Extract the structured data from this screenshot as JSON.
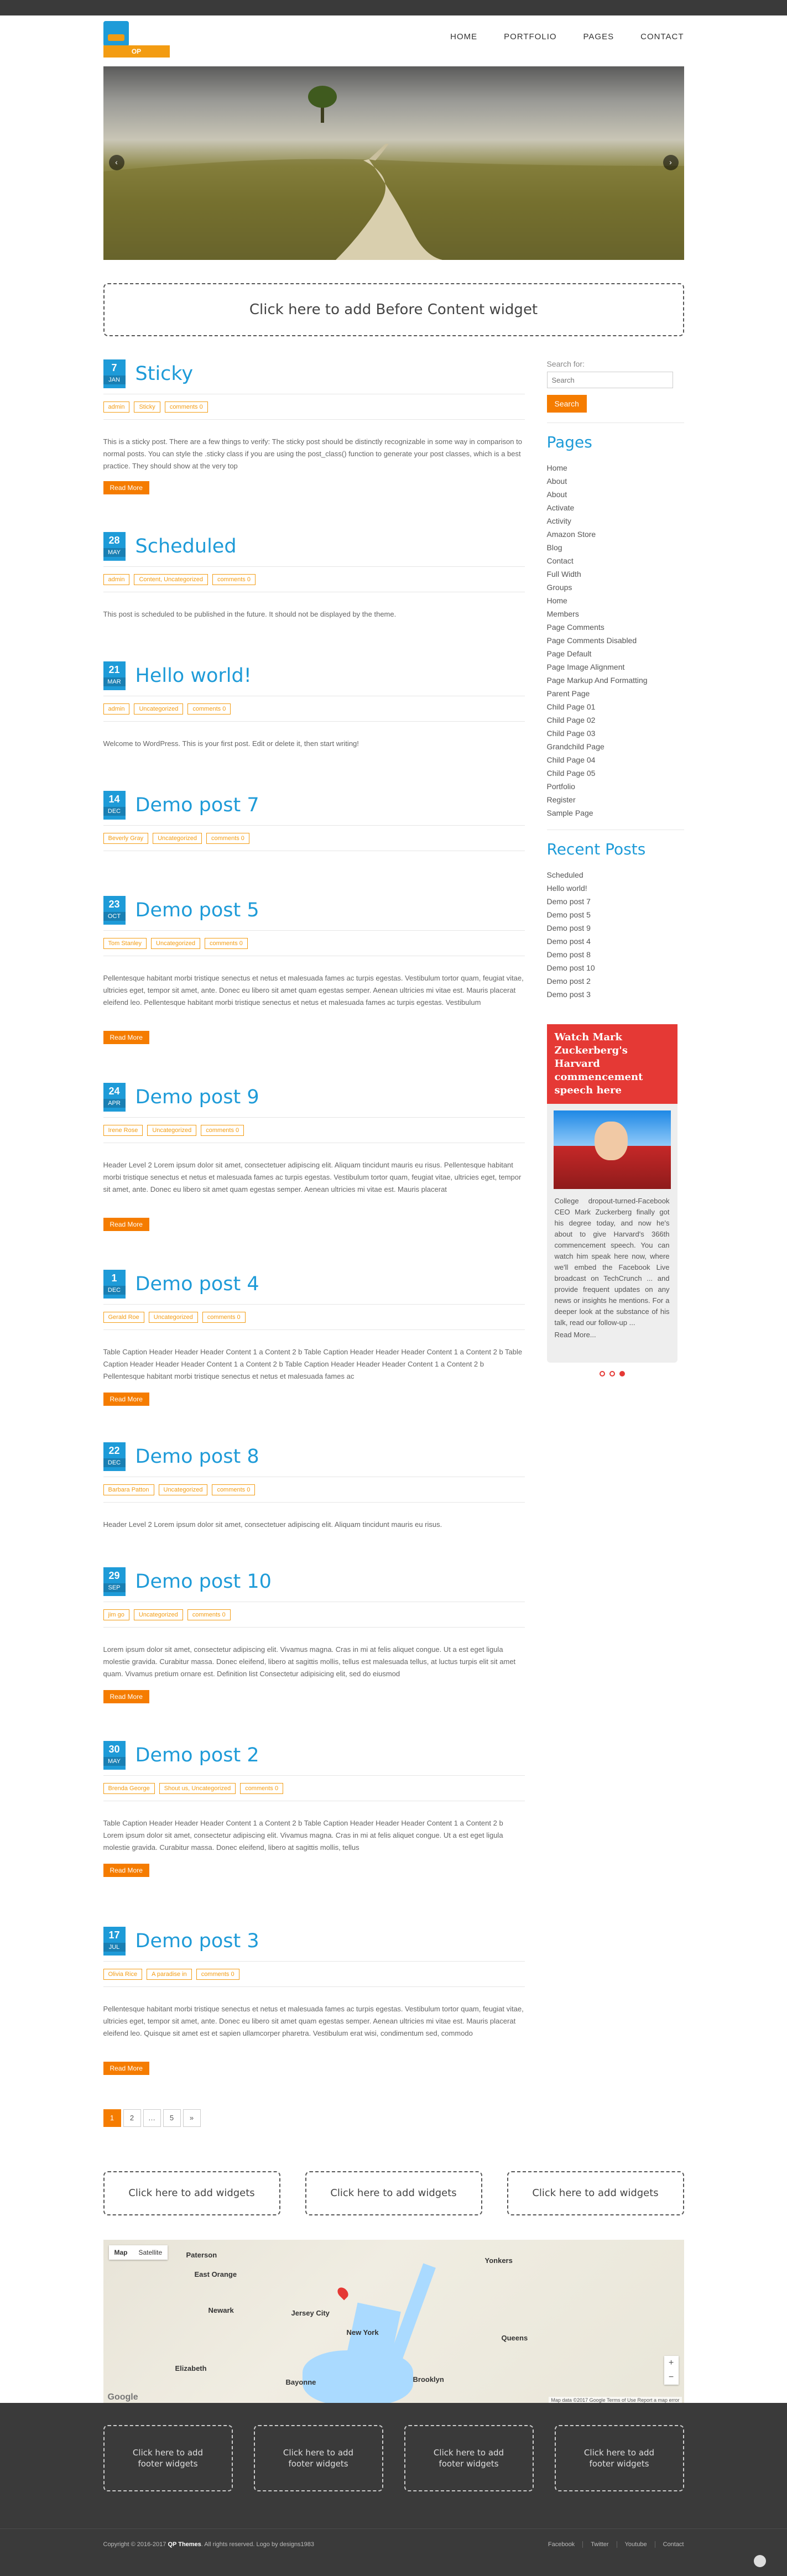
{
  "header": {
    "logo_text": "OP",
    "nav": [
      "HOME",
      "PORTFOLIO",
      "PAGES",
      "CONTACT"
    ]
  },
  "slider": {
    "prev": "‹",
    "next": "›"
  },
  "before_content_widget": "Click here to add Before Content widget",
  "posts": [
    {
      "day": "7",
      "month": "JAN",
      "title": "Sticky",
      "meta": [
        "admin",
        "Sticky",
        "comments 0"
      ],
      "excerpt": "This is a sticky post. There are a few things to verify: The sticky post should be distinctly recognizable in some way in comparison to normal posts. You can style the .sticky class if you are using the post_class() function to generate your post classes, which is a best practice. They should show at the very top",
      "read_more": "Read More"
    },
    {
      "day": "28",
      "month": "MAY",
      "title": "Scheduled",
      "meta": [
        "admin",
        "Content, Uncategorized",
        "comments 0"
      ],
      "excerpt": "This post is scheduled to be published in the future. It should not be displayed by the theme.",
      "read_more": ""
    },
    {
      "day": "21",
      "month": "MAR",
      "title": "Hello world!",
      "meta": [
        "admin",
        "Uncategorized",
        "comments 0"
      ],
      "excerpt": "Welcome to WordPress. This is your first post. Edit or delete it, then start writing!",
      "read_more": ""
    },
    {
      "day": "14",
      "month": "DEC",
      "title": "Demo post 7",
      "meta": [
        "Beverly Gray",
        "Uncategorized",
        "comments 0"
      ],
      "excerpt": "",
      "read_more": ""
    },
    {
      "day": "23",
      "month": "OCT",
      "title": "Demo post 5",
      "meta": [
        "Tom Stanley",
        "Uncategorized",
        "comments 0"
      ],
      "excerpt": "Pellentesque habitant morbi tristique senectus et netus et malesuada fames ac turpis egestas. Vestibulum tortor quam, feugiat vitae, ultricies eget, tempor sit amet, ante. Donec eu libero sit amet quam egestas semper. Aenean ultricies mi vitae est. Mauris placerat eleifend leo. Pellentesque habitant morbi tristique senectus et netus et malesuada fames ac turpis egestas. Vestibulum",
      "read_more": "Read More"
    },
    {
      "day": "24",
      "month": "APR",
      "title": "Demo post 9",
      "meta": [
        "Irene Rose",
        "Uncategorized",
        "comments 0"
      ],
      "excerpt": "Header Level 2 Lorem ipsum dolor sit amet, consectetuer adipiscing elit. Aliquam tincidunt mauris eu risus. Pellentesque habitant morbi tristique senectus et netus et malesuada fames ac turpis egestas. Vestibulum tortor quam, feugiat vitae, ultricies eget, tempor sit amet, ante. Donec eu libero sit amet quam egestas semper. Aenean ultricies mi vitae est. Mauris placerat",
      "read_more": "Read More"
    },
    {
      "day": "1",
      "month": "DEC",
      "title": "Demo post 4",
      "meta": [
        "Gerald Roe",
        "Uncategorized",
        "comments 0"
      ],
      "excerpt": "Table Caption Header Header Header Content 1 a Content 2 b Table Caption Header Header Header Content 1 a Content 2 b Table Caption Header Header Header Content 1 a Content 2 b Table Caption Header Header Header Content 1 a Content 2 b Pellentesque habitant morbi tristique senectus et netus et malesuada fames ac",
      "read_more": "Read More"
    },
    {
      "day": "22",
      "month": "DEC",
      "title": "Demo post 8",
      "meta": [
        "Barbara Patton",
        "Uncategorized",
        "comments 0"
      ],
      "excerpt": "Header Level 2 Lorem ipsum dolor sit amet, consectetuer adipiscing elit. Aliquam tincidunt mauris eu risus.",
      "read_more": ""
    },
    {
      "day": "29",
      "month": "SEP",
      "title": "Demo post 10",
      "meta": [
        "jim go",
        "Uncategorized",
        "comments 0"
      ],
      "excerpt": "Lorem ipsum dolor sit amet, consectetur adipiscing elit. Vivamus magna. Cras in mi at felis aliquet congue. Ut a est eget ligula molestie gravida. Curabitur massa. Donec eleifend, libero at sagittis mollis, tellus est malesuada tellus, at luctus turpis elit sit amet quam. Vivamus pretium ornare est. Definition list Consectetur adipisicing elit, sed do eiusmod",
      "read_more": "Read More"
    },
    {
      "day": "30",
      "month": "MAY",
      "title": "Demo post 2",
      "meta": [
        "Brenda George",
        "Shout us, Uncategorized",
        "comments 0"
      ],
      "excerpt": "Table Caption Header Header Header Content 1 a Content 2 b Table Caption Header Header Header Content 1 a Content 2 b Lorem ipsum dolor sit amet, consectetur adipiscing elit. Vivamus magna. Cras in mi at felis aliquet congue. Ut a est eget ligula molestie gravida. Curabitur massa. Donec eleifend, libero at sagittis mollis, tellus",
      "read_more": "Read More"
    },
    {
      "day": "17",
      "month": "JUL",
      "title": "Demo post 3",
      "meta": [
        "Olivia Rice",
        "A paradise in",
        "comments 0"
      ],
      "excerpt": "Pellentesque habitant morbi tristique senectus et netus et malesuada fames ac turpis egestas. Vestibulum tortor quam, feugiat vitae, ultricies eget, tempor sit amet, ante. Donec eu libero sit amet quam egestas semper. Aenean ultricies mi vitae est. Mauris placerat eleifend leo. Quisque sit amet est et sapien ullamcorper pharetra. Vestibulum erat wisi, condimentum sed, commodo",
      "read_more": "Read More"
    }
  ],
  "pagination": [
    "1",
    "2",
    "…",
    "5",
    "»"
  ],
  "sidebar": {
    "search_label": "Search for:",
    "search_placeholder": "Search",
    "search_button": "Search",
    "pages_title": "Pages",
    "pages": [
      "Home",
      "About",
      "About",
      "Activate",
      "Activity",
      "Amazon Store",
      "Blog",
      "Contact",
      "Full Width",
      "Groups",
      "Home",
      "Members",
      "Page Comments",
      "Page Comments Disabled",
      "Page Default",
      "Page Image Alignment",
      "Page Markup And Formatting",
      "Parent Page",
      "Child Page 01",
      "Child Page 02",
      "Child Page 03",
      "Grandchild Page",
      "Child Page 04",
      "Child Page 05",
      "Portfolio",
      "Register",
      "Sample Page"
    ],
    "recent_title": "Recent Posts",
    "recent": [
      "Scheduled",
      "Hello world!",
      "Demo post 7",
      "Demo post 5",
      "Demo post 9",
      "Demo post 4",
      "Demo post 8",
      "Demo post 10",
      "Demo post 2",
      "Demo post 3"
    ],
    "promo_title": "Watch Mark Zuckerberg's Harvard commencement speech here",
    "promo_text": "College dropout-turned-Facebook CEO Mark Zuckerberg finally got his degree today, and now he's about to give Harvard's 366th commencement speech. You can watch him speak here now, where we'll embed the Facebook Live broadcast on TechCrunch ... and provide frequent updates on any news or insights he mentions. For a deeper look at the substance of his talk, read our follow-up ...",
    "promo_more": "Read More..."
  },
  "bottom_widgets": [
    "Click here to add widgets",
    "Click here to add widgets",
    "Click here to add widgets"
  ],
  "map": {
    "type_map": "Map",
    "type_satellite": "Satellite",
    "labels": [
      "East Orange",
      "Newark",
      "Jersey City",
      "New York",
      "Elizabeth",
      "Paterson",
      "Yonkers",
      "Bayonne",
      "Queens",
      "Brooklyn"
    ],
    "zoom_in": "+",
    "zoom_out": "−",
    "google": "Google",
    "attribution": "Map data ©2017 Google  Terms of Use  Report a map error"
  },
  "footer": {
    "widgets": [
      "Click here to add footer widgets",
      "Click here to add footer widgets",
      "Click here to add footer widgets",
      "Click here to add footer widgets"
    ],
    "copyright_pre": "Copyright © 2016-2017",
    "copyright_brand": "QP Themes",
    "copyright_post": ". All rights reserved. Logo by designs1983",
    "links": [
      "Facebook",
      "Twitter",
      "Youtube",
      "Contact"
    ]
  }
}
